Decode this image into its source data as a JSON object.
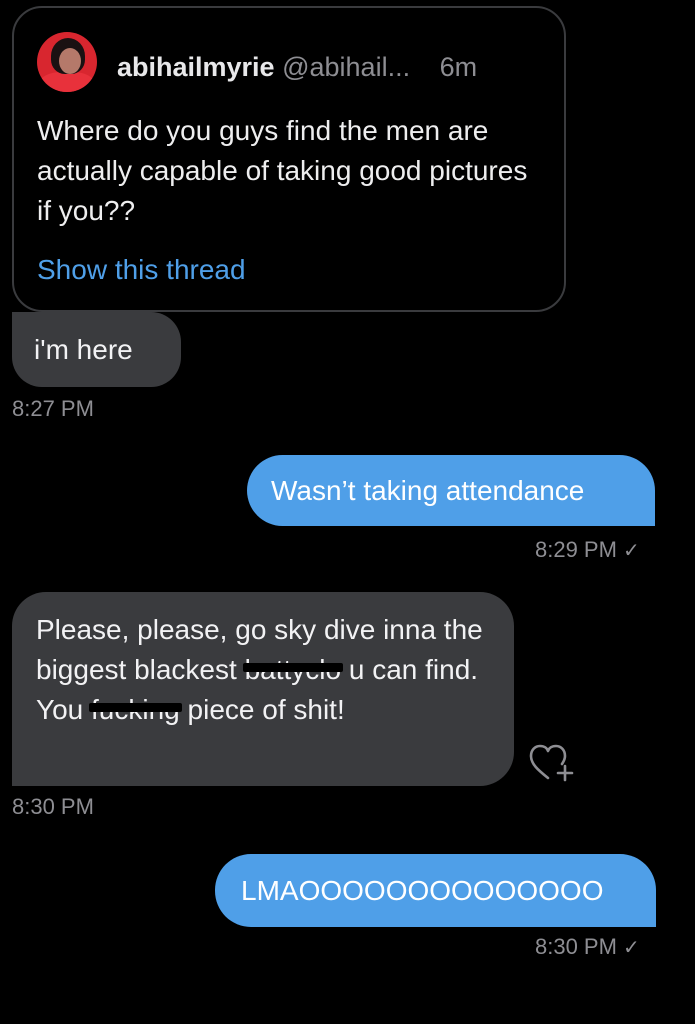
{
  "quoted_tweet": {
    "display_name": "abihailmyrie",
    "handle": "@abihail...",
    "age": "6m",
    "text": "Where do you guys find the men are actually capable of taking good pictures if you??",
    "show_thread_label": "Show this thread"
  },
  "messages": [
    {
      "direction": "incoming",
      "text": "i'm here",
      "time": "8:27 PM"
    },
    {
      "direction": "outgoing",
      "text": "Wasn’t taking attendance",
      "time": "8:29 PM"
    },
    {
      "direction": "incoming",
      "text_parts": [
        "Please, please, go sky dive inna the biggest blackest ",
        "battyclo",
        " u can find. You ",
        "fucking",
        " piece of shit!"
      ],
      "time": "8:30 PM"
    },
    {
      "direction": "outgoing",
      "text": "LMAOOOOOOOOOOOOOO",
      "time": "8:30 PM"
    }
  ],
  "read_receipt_glyph": "✓",
  "icons": {
    "react": "heart-plus-icon",
    "avatar": "profile-photo"
  },
  "colors": {
    "background": "#000000",
    "incoming_bubble": "#3a3b3e",
    "outgoing_bubble": "#4f9fe8",
    "link": "#4f9fe8",
    "muted_text": "#8e8e93"
  }
}
